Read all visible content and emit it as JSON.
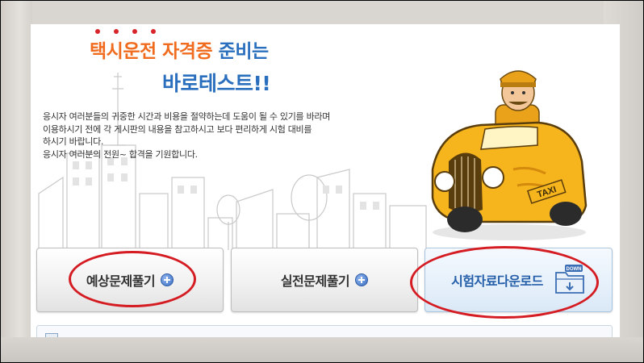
{
  "headline": {
    "line1_orange": "택시운전 자격증",
    "line1_blue": "준비는",
    "line2": "바로테스트!!"
  },
  "intro": {
    "lines": [
      "응시자 여러분들의 귀중한 시간과 비용을 절약하는데 도움이 될 수 있기를 바라며",
      "이용하시기  전에 각 게시판의 내용을 참고하시고 보다 편리하게 시험 대비를",
      "하시기 바랍니다.",
      "응시자 여러분의 전원~ 합격을 기원합니다."
    ]
  },
  "taxi": {
    "sign": "TAXI"
  },
  "buttons": {
    "expected_label": "예상문제풀기",
    "practice_label": "실전문제풀기",
    "download_label": "시험자료다운로드",
    "download_icon_text": "DOWN"
  },
  "colors": {
    "orange": "#f06b1e",
    "blue": "#2a6fbd",
    "annotation_red": "#d41c22",
    "taxi_yellow": "#f6b51d"
  }
}
